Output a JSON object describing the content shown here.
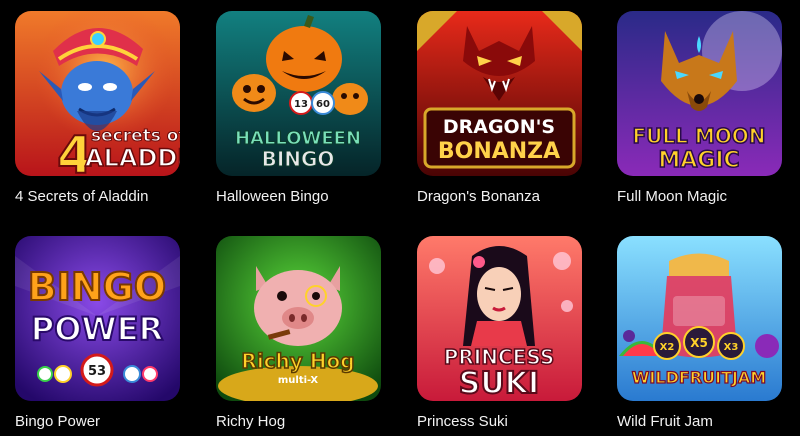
{
  "games": [
    {
      "title": "4 Secrets of Aladdin",
      "art_line1": "secrets of",
      "art_number": "4",
      "art_line2": "ALADDIN",
      "colors": {
        "bg_top": "#e8542a",
        "bg_bottom": "#c41a1a",
        "accent": "#ffd23a"
      },
      "icon": "genie-icon"
    },
    {
      "title": "Halloween Bingo",
      "art_line1": "HALLOWEEN",
      "art_line2": "BINGO",
      "balls": [
        "13",
        "60"
      ],
      "colors": {
        "bg_top": "#0e6a6a",
        "bg_bottom": "#062a2e",
        "accent": "#ff8a1c"
      },
      "icon": "pumpkin-icon"
    },
    {
      "title": "Dragon's Bonanza",
      "art_line1": "DRAGON'S",
      "art_line2": "BONANZA",
      "colors": {
        "bg_top": "#d41818",
        "bg_bottom": "#5a0606",
        "accent": "#ffd24a"
      },
      "icon": "dragon-icon"
    },
    {
      "title": "Full Moon Magic",
      "art_line1": "FULL MOON",
      "art_line2": "MAGIC",
      "colors": {
        "bg_top": "#3a3aa8",
        "bg_bottom": "#7a2aa8",
        "accent": "#4ad8ff"
      },
      "icon": "wolf-icon"
    },
    {
      "title": "Bingo Power",
      "art_line1": "BINGO",
      "art_line2": "POWER",
      "ball": "53",
      "colors": {
        "bg_top": "#5a28c8",
        "bg_bottom": "#2a0e7a",
        "accent": "#ff9a1a"
      },
      "icon": "bingo-ball-icon"
    },
    {
      "title": "Richy Hog",
      "art_line1": "Richy Hog",
      "art_line2": "multi-X",
      "colors": {
        "bg_top": "#2a9a2a",
        "bg_bottom": "#0e4a0e",
        "accent": "#ffd22a"
      },
      "icon": "pig-icon"
    },
    {
      "title": "Princess Suki",
      "art_line1": "PRINCESS",
      "art_line2": "SUKI",
      "colors": {
        "bg_top": "#ff6a5a",
        "bg_bottom": "#d41a3a",
        "accent": "#ffffff"
      },
      "icon": "princess-icon"
    },
    {
      "title": "Wild Fruit Jam",
      "art_line1": "WILDFRUITJAM",
      "multipliers": [
        "X2",
        "X5",
        "X3"
      ],
      "colors": {
        "bg_top": "#7ad8ff",
        "bg_bottom": "#2a8ad8",
        "accent": "#ff3a6a"
      },
      "icon": "jam-jar-icon"
    }
  ]
}
